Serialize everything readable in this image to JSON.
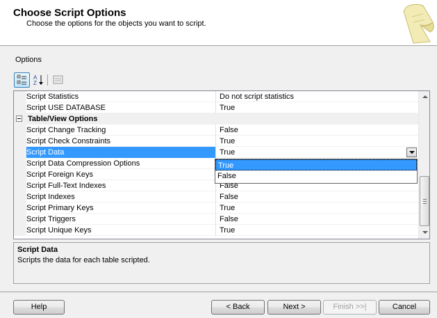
{
  "header": {
    "title": "Choose Script Options",
    "subtitle": "Choose the options for the objects you want to script."
  },
  "options_label": "Options",
  "toolbar": {
    "categorized_icon": "categorized-view-icon",
    "alphabetical_icon": "alphabetical-sort-icon",
    "property_pages_icon": "property-pages-icon"
  },
  "grid": {
    "rows": [
      {
        "name": "Script Statistics",
        "value": "Do not script statistics"
      },
      {
        "name": "Script USE DATABASE",
        "value": "True"
      },
      {
        "name": "Table/View Options",
        "value": "",
        "category": true
      },
      {
        "name": "Script Change Tracking",
        "value": "False"
      },
      {
        "name": "Script Check Constraints",
        "value": "True"
      },
      {
        "name": "Script Data",
        "value": "True",
        "selected": true
      },
      {
        "name": "Script Data Compression Options",
        "value": ""
      },
      {
        "name": "Script Foreign Keys",
        "value": ""
      },
      {
        "name": "Script Full-Text Indexes",
        "value": "False"
      },
      {
        "name": "Script Indexes",
        "value": "False"
      },
      {
        "name": "Script Primary Keys",
        "value": "True"
      },
      {
        "name": "Script Triggers",
        "value": "False"
      },
      {
        "name": "Script Unique Keys",
        "value": "True"
      }
    ]
  },
  "dropdown": {
    "options": [
      "True",
      "False"
    ],
    "highlighted": "True"
  },
  "description": {
    "title": "Script Data",
    "text": "Scripts the data for each table scripted."
  },
  "buttons": {
    "help": "Help",
    "back": "< Back",
    "next": "Next >",
    "finish": "Finish >>|",
    "cancel": "Cancel"
  },
  "colors": {
    "selection": "#3399ff",
    "header_bg": "#ffffff",
    "dialog_bg": "#f0f0f0"
  }
}
